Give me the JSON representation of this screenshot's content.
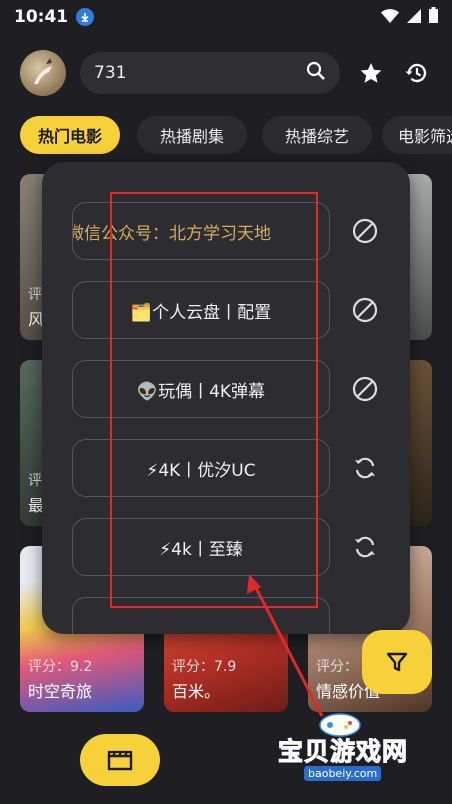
{
  "status_bar": {
    "time": "10:41"
  },
  "search": {
    "value": "731"
  },
  "tabs": [
    {
      "label": "热门电影",
      "active": true
    },
    {
      "label": "热播剧集",
      "active": false
    },
    {
      "label": "热播综艺",
      "active": false
    },
    {
      "label": "电影筛选",
      "active": false
    }
  ],
  "cards": [
    {
      "rating": "评",
      "title": "风",
      "color": "#6c6458"
    },
    {
      "rating": "",
      "title": "",
      "color": "#585450"
    },
    {
      "rating": "",
      "title": "",
      "color": "#6d6f6e"
    },
    {
      "rating": "评",
      "title": "最",
      "color": "#3a463e"
    },
    {
      "rating": "",
      "title": "",
      "color": "#2d2a25"
    },
    {
      "rating": "",
      "title": "",
      "color": "#4e3d2a"
    },
    {
      "rating": "评分：9.2",
      "title": "时空奇旅",
      "color": "#cfd6e0"
    },
    {
      "rating": "评分：7.9",
      "title": "百米。",
      "color": "#d24f3c"
    },
    {
      "rating": "评分：",
      "title": "情感价值",
      "color": "#c6a591"
    }
  ],
  "sources": [
    {
      "label": "微信公众号：北方学习天地",
      "action": "disabled"
    },
    {
      "label": "🗂️个人云盘丨配置",
      "action": "disabled"
    },
    {
      "label": "👽玩偶丨4K弹幕",
      "action": "disabled"
    },
    {
      "label": "⚡4K丨优汐UC",
      "action": "refresh"
    },
    {
      "label": "⚡4k丨至臻",
      "action": "refresh"
    }
  ],
  "watermark": {
    "main": "宝贝游戏网",
    "sub": "baobeiy.com"
  },
  "colors": {
    "accent": "#f6d13a",
    "background": "#1f1f23",
    "annotation": "#e02a2a"
  }
}
